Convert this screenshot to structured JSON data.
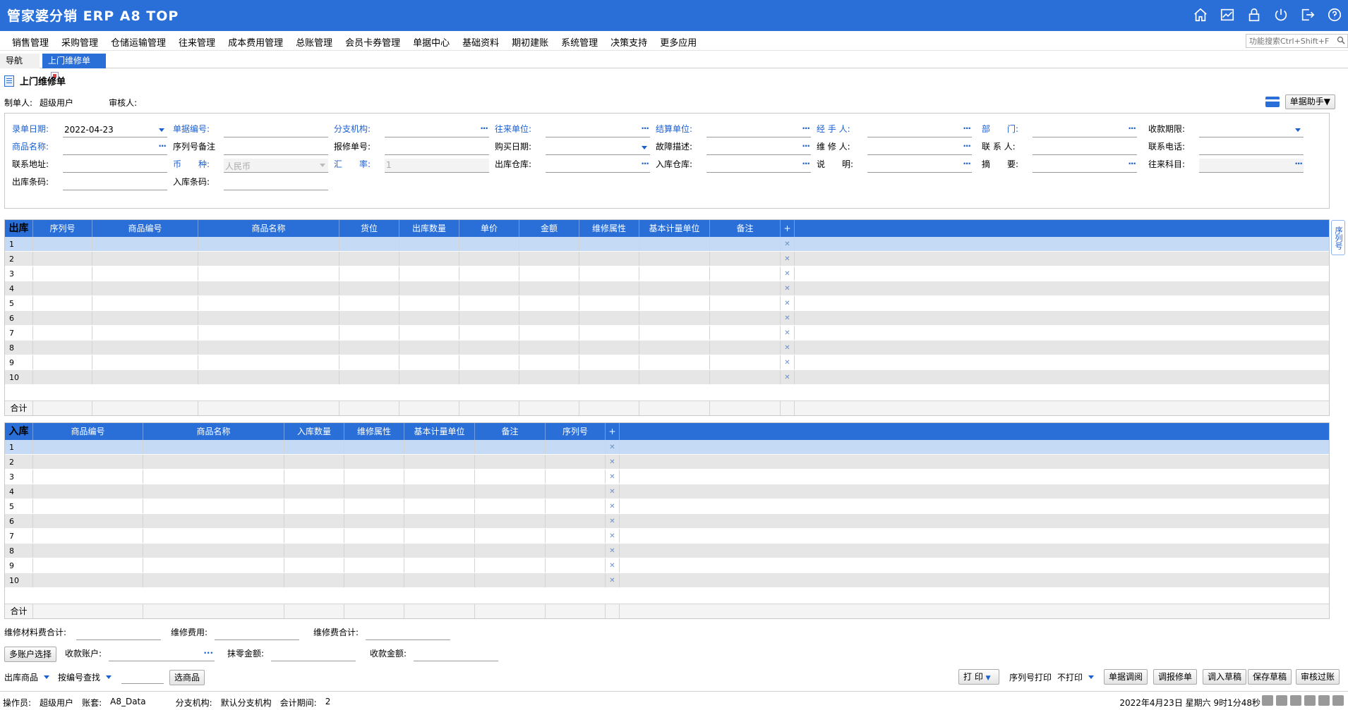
{
  "app": {
    "title": "管家婆分销 ERP A8 TOP"
  },
  "titlebar_icons": [
    "home-icon",
    "chart-icon",
    "lock-icon",
    "power-icon",
    "exit-icon",
    "help-icon"
  ],
  "menu": [
    "销售管理",
    "采购管理",
    "仓储运输管理",
    "往来管理",
    "成本费用管理",
    "总账管理",
    "会员卡券管理",
    "单据中心",
    "基础资料",
    "期初建账",
    "系统管理",
    "决策支持",
    "更多应用"
  ],
  "search": {
    "placeholder": "功能搜索Ctrl+Shift+F"
  },
  "tabs": {
    "nav": "导航",
    "active": "上门维修单"
  },
  "page": {
    "title": "上门维修单"
  },
  "meta": {
    "creator_label": "制单人:",
    "creator_value": "超级用户",
    "auditor_label": "审核人:"
  },
  "assist_button": "单据助手▼",
  "form": {
    "row1": [
      {
        "label": "录单日期:",
        "value": "2022-04-23",
        "blue": true,
        "suffix": "caret"
      },
      {
        "label": "单据编号:",
        "value": "",
        "blue": true,
        "suffix": ""
      },
      {
        "label": "分支机构:",
        "value": "",
        "blue": true,
        "suffix": "dots"
      },
      {
        "label": "往来单位:",
        "value": "",
        "blue": true,
        "suffix": "dots"
      },
      {
        "label": "结算单位:",
        "value": "",
        "blue": true,
        "suffix": "dots"
      },
      {
        "label": "经 手 人:",
        "value": "",
        "blue": true,
        "suffix": "dots"
      },
      {
        "label": "部　　门:",
        "value": "",
        "blue": true,
        "suffix": "dots"
      },
      {
        "label": "收款期限:",
        "value": "",
        "blue": false,
        "suffix": "caret"
      }
    ],
    "row2": [
      {
        "label": "商品名称:",
        "value": "",
        "blue": true,
        "suffix": "dots"
      },
      {
        "label": "序列号备注",
        "value": "",
        "blue": false,
        "suffix": ""
      },
      {
        "label": "报修单号:",
        "value": "",
        "blue": false,
        "suffix": ""
      },
      {
        "label": "购买日期:",
        "value": "",
        "blue": false,
        "suffix": "caret"
      },
      {
        "label": "故障描述:",
        "value": "",
        "blue": false,
        "suffix": "dots"
      },
      {
        "label": "维 修 人:",
        "value": "",
        "blue": false,
        "suffix": "dots"
      },
      {
        "label": "联 系 人:",
        "value": "",
        "blue": false,
        "suffix": ""
      },
      {
        "label": "联系电话:",
        "value": "",
        "blue": false,
        "suffix": ""
      }
    ],
    "row3": [
      {
        "label": "联系地址:",
        "value": "",
        "blue": false,
        "suffix": ""
      },
      {
        "label": "币　　种:",
        "value": "人民币",
        "blue": true,
        "suffix": "caret-gray",
        "disabled": true
      },
      {
        "label": "汇　　率:",
        "value": "1",
        "blue": true,
        "suffix": "",
        "disabled": true
      },
      {
        "label": "出库仓库:",
        "value": "",
        "blue": false,
        "suffix": "dots"
      },
      {
        "label": "入库仓库:",
        "value": "",
        "blue": false,
        "suffix": "dots"
      },
      {
        "label": "说　　明:",
        "value": "",
        "blue": false,
        "suffix": "dots"
      },
      {
        "label": "摘　　要:",
        "value": "",
        "blue": false,
        "suffix": "dots"
      },
      {
        "label": "往来科目:",
        "value": "",
        "blue": false,
        "suffix": "dots",
        "disabled": true
      }
    ],
    "row4": [
      {
        "label": "出库条码:",
        "value": "",
        "blue": false,
        "suffix": ""
      },
      {
        "label": "入库条码:",
        "value": "",
        "blue": false,
        "suffix": ""
      }
    ]
  },
  "out_grid": {
    "title": "出库",
    "columns": [
      "序列号",
      "商品编号",
      "商品名称",
      "货位",
      "出库数量",
      "单价",
      "金额",
      "维修属性",
      "基本计量单位",
      "备注",
      "+"
    ],
    "rows": [
      "1",
      "2",
      "3",
      "4",
      "5",
      "6",
      "7",
      "8",
      "9",
      "10"
    ],
    "total_label": "合计"
  },
  "in_grid": {
    "title": "入库",
    "columns": [
      "商品编号",
      "商品名称",
      "入库数量",
      "维修属性",
      "基本计量单位",
      "备注",
      "序列号",
      "+"
    ],
    "rows": [
      "1",
      "2",
      "3",
      "4",
      "5",
      "6",
      "7",
      "8",
      "9",
      "10"
    ],
    "total_label": "合计"
  },
  "side_tab": "序列号",
  "bottom": {
    "material_total": "维修材料费合计:",
    "repair_fee": "维修费用:",
    "repair_total": "维修费合计:",
    "multi_account": "多账户选择",
    "receive_account": "收款账户:",
    "discount": "抹零金额:",
    "receive_amount": "收款金额:",
    "out_goods": "出库商品",
    "by_serial": "按编号查找",
    "select_goods": "选商品",
    "print": "打 印",
    "serial_print": "序列号打印",
    "no_print": "不打印",
    "btn_recall": "单据调阅",
    "btn_repair": "调报修单",
    "btn_draft_in": "调入草稿",
    "btn_save_draft": "保存草稿",
    "btn_audit": "审核过账"
  },
  "status": {
    "operator_label": "操作员:",
    "operator": "超级用户",
    "account_label": "账套:",
    "account": "A8_Data",
    "branch_label": "分支机构:",
    "branch": "默认分支机构",
    "period_label": "会计期间:",
    "period": "2",
    "datetime": "2022年4月23日 星期六 9时1分48秒"
  },
  "colors": {
    "accent": "#2a6fd8",
    "label_blue": "#1a5fd0",
    "row_selected": "#c5daf5",
    "row_alt": "#e6e6e6"
  }
}
